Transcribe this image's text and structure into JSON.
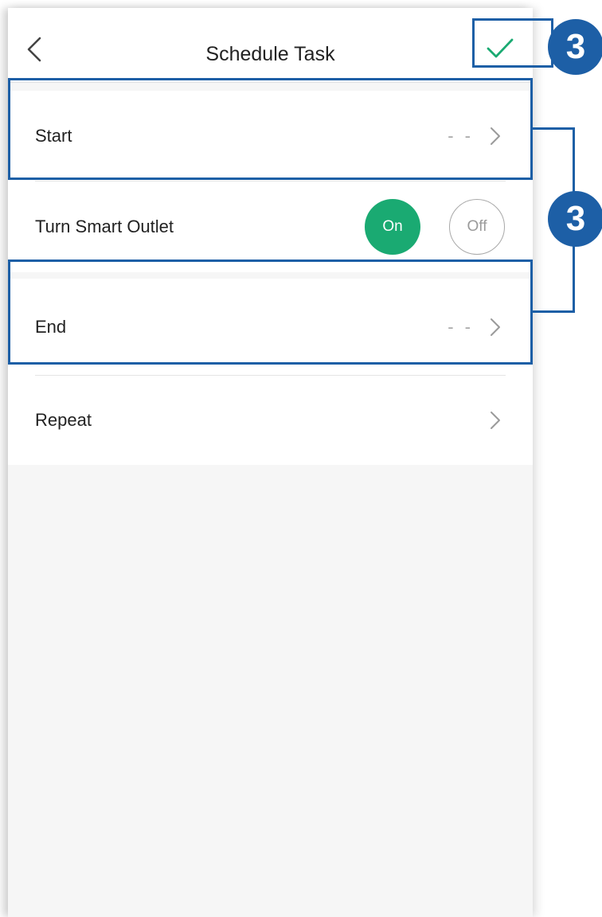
{
  "header": {
    "title": "Schedule Task",
    "back_icon": "chevron-left-icon",
    "confirm_icon": "checkmark-icon",
    "confirm_color": "#1aaa72"
  },
  "rows": {
    "start": {
      "label": "Start",
      "value": "- -"
    },
    "toggle": {
      "label": "Turn Smart Outlet",
      "on_label": "On",
      "off_label": "Off",
      "selected": "On"
    },
    "end": {
      "label": "End",
      "value": "- -"
    },
    "repeat": {
      "label": "Repeat"
    }
  },
  "annotations": {
    "confirm_badge": "3",
    "rows_badge": "3",
    "color": "#1d5fa6"
  },
  "colors": {
    "accent": "#1aaa72",
    "background": "#f6f6f6",
    "annotation": "#1d5fa6"
  }
}
